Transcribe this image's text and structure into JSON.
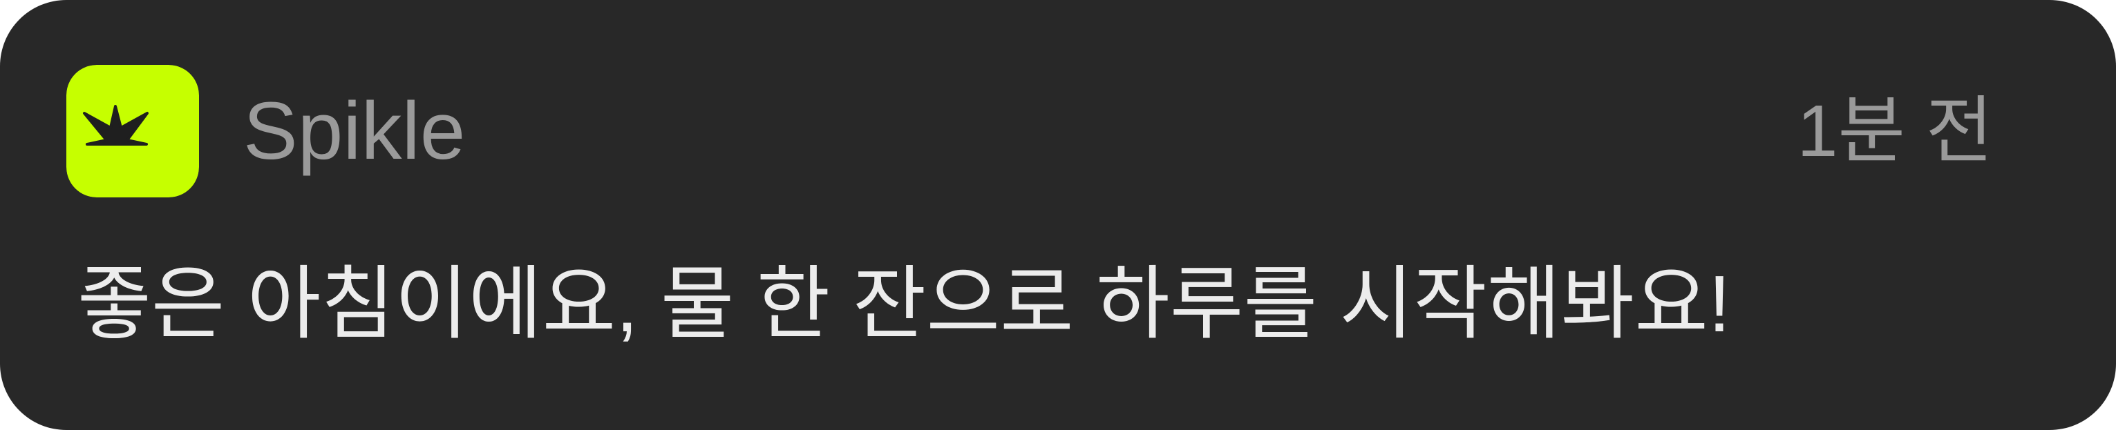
{
  "notification": {
    "app_name": "Spikle",
    "timestamp": "1분 전",
    "message": "좋은 아침이에요, 물 한 잔으로 하루를 시작해봐요!",
    "icon_name": "spikle-crown-icon"
  },
  "colors": {
    "background": "#282828",
    "app_icon_bg": "#C6FF00",
    "app_icon_glyph": "#1F1F1F",
    "secondary_text": "#9A9A9A",
    "primary_text": "#ECECEC"
  }
}
